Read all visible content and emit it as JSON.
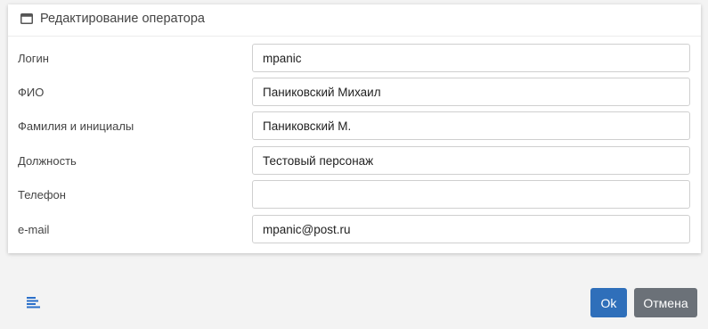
{
  "dialog": {
    "title": "Редактирование оператора",
    "title_icon": "window-icon"
  },
  "form": {
    "fields": [
      {
        "label": "Логин",
        "value": "mpanic"
      },
      {
        "label": "ФИО",
        "value": "Паниковский Михаил"
      },
      {
        "label": "Фамилия и инициалы",
        "value": "Паниковский М."
      },
      {
        "label": "Должность",
        "value": "Тестовый персонаж"
      },
      {
        "label": "Телефон",
        "value": ""
      },
      {
        "label": "e-mail",
        "value": "mpanic@post.ru"
      }
    ]
  },
  "footer": {
    "menu_icon": "menu-lines-icon",
    "ok_label": "Ok",
    "cancel_label": "Отмена"
  },
  "colors": {
    "accent": "#2f6fba",
    "cancel": "#6b7178",
    "menu_icon": "#2a6fc9"
  }
}
